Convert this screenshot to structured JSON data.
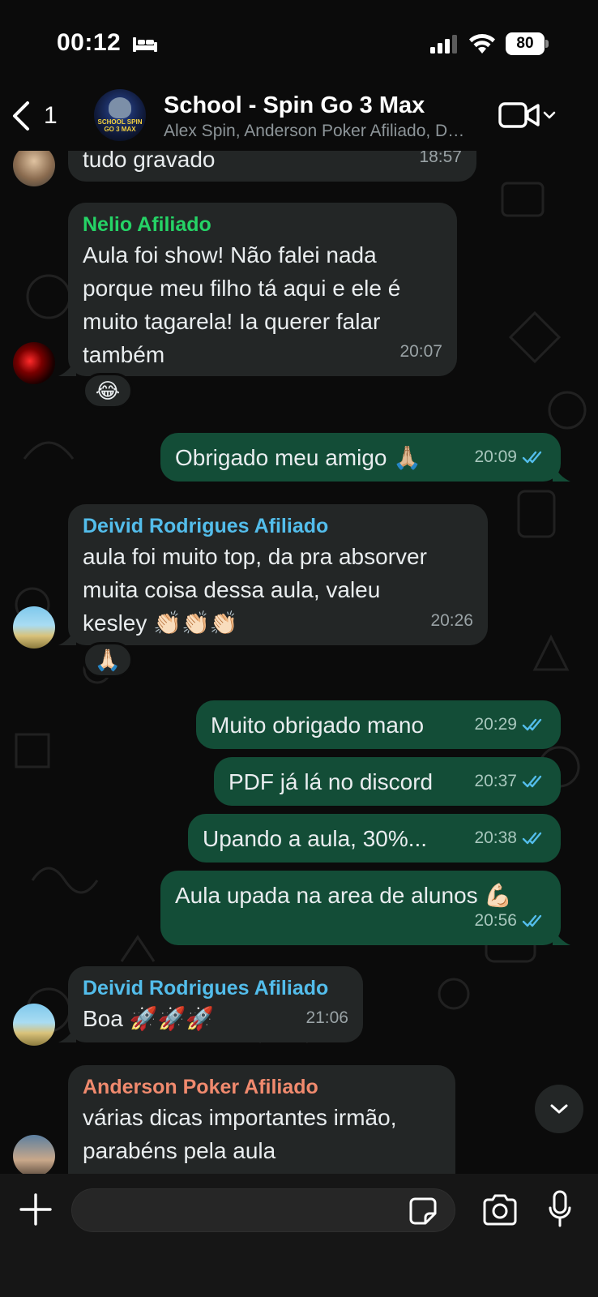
{
  "status_bar": {
    "time": "00:12",
    "battery": "80"
  },
  "header": {
    "back_count": "1",
    "title": "School - Spin Go 3 Max",
    "subtitle": "Alex Spin, Anderson Poker Afiliado, Deivid Rodrigues Afiliado, Nelio Afiliado",
    "avatar_text": "SCHOOL SPIN GO 3 MAX"
  },
  "messages": [
    {
      "text": "tudo gravado",
      "time": "18:57"
    },
    {
      "sender": "Nelio Afiliado",
      "sender_color": "#25d366",
      "text": "Aula foi show! Não falei nada\nporque meu filho tá aqui e ele é\nmuito tagarela! Ia querer falar\ntambém",
      "time": "20:07",
      "reaction": "😂"
    },
    {
      "text": "Obrigado meu amigo 🙏🏼",
      "time": "20:09"
    },
    {
      "sender": "Deivid Rodrigues Afiliado",
      "sender_color": "#53bdeb",
      "text": "aula foi muito top, da pra absorver\nmuita coisa dessa aula, valeu\nkesley 👏🏻👏🏻👏🏻",
      "time": "20:26",
      "reaction": "🙏🏻"
    },
    {
      "text": "Muito obrigado mano",
      "time": "20:29"
    },
    {
      "text": "PDF já lá no discord",
      "time": "20:37"
    },
    {
      "text": "Upando a aula, 30%...",
      "time": "20:38"
    },
    {
      "text": "Aula upada na area de alunos 💪🏻",
      "time": "20:56"
    },
    {
      "sender": "Deivid Rodrigues Afiliado",
      "sender_color": "#53bdeb",
      "text": "Boa 🚀🚀🚀",
      "time": "21:06"
    },
    {
      "sender": "Anderson Poker Afiliado",
      "sender_color": "#f08a6e",
      "text": "várias dicas importantes irmão,\nparabéns pela aula"
    }
  ],
  "composer": {
    "placeholder": ""
  },
  "colors": {
    "outgoing_bubble": "#134d37",
    "incoming_bubble": "#232626",
    "read_ticks": "#53bdeb"
  }
}
